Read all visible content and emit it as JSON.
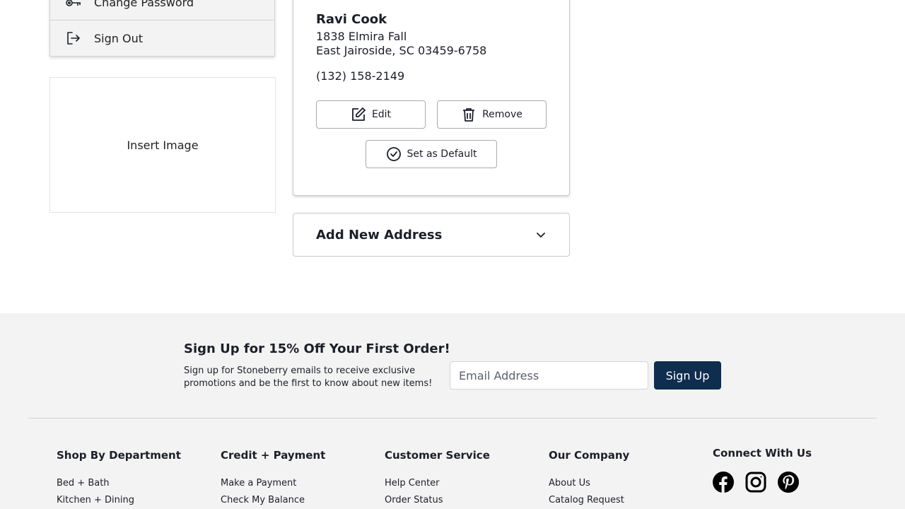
{
  "account_menu": {
    "items": [
      {
        "label": "Change Password",
        "icon": "key-icon"
      },
      {
        "label": "Sign Out",
        "icon": "sign-out-icon"
      }
    ]
  },
  "image_placeholder": {
    "label": "Insert Image"
  },
  "address_card": {
    "name": "Ravi Cook",
    "street": "1838 Elmira Fall",
    "city_state_zip": "East Jairoside, SC 03459-6758",
    "phone": "(132) 158-2149",
    "edit_label": "Edit",
    "remove_label": "Remove",
    "default_label": "Set as Default"
  },
  "add_new_address": {
    "label": "Add New Address"
  },
  "footer": {
    "signup": {
      "title": "Sign Up for 15% Off Your First Order!",
      "description": "Sign up for Stoneberry emails to receive exclusive promotions and be the first to know about new items!",
      "email_placeholder": "Email Address",
      "button_label": "Sign Up",
      "button_color": "#0f2d4f"
    },
    "columns": [
      {
        "title": "Shop By Department",
        "links": [
          "Bed + Bath",
          "Kitchen + Dining"
        ]
      },
      {
        "title": "Credit + Payment",
        "links": [
          "Make a Payment",
          "Check My Balance"
        ]
      },
      {
        "title": "Customer Service",
        "links": [
          "Help Center",
          "Order Status"
        ]
      },
      {
        "title": "Our Company",
        "links": [
          "About Us",
          "Catalog Request"
        ]
      }
    ],
    "connect": {
      "title": "Connect With Us",
      "icons": [
        "facebook-icon",
        "instagram-icon",
        "pinterest-icon"
      ]
    }
  }
}
